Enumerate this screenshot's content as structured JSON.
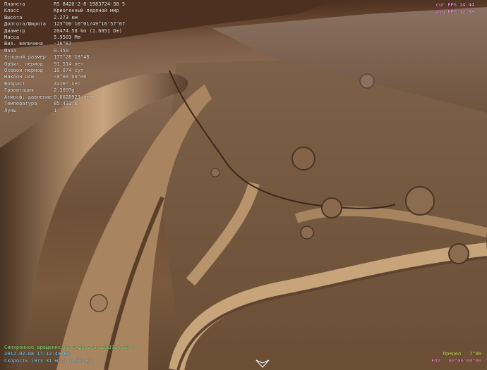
{
  "object_info": {
    "rows": [
      {
        "label": "Планета",
        "value": "RS 8420-2-8-1983724-38 5"
      },
      {
        "label": "Класс",
        "value": "Криогенный ледяной мир"
      },
      {
        "label": "Высота",
        "value": "2.273 км"
      },
      {
        "label": "Долгота/Широта",
        "value": "123°00'10\"01/49°16'57\"67"
      },
      {
        "label": "Диаметр",
        "value": "20474.58 km (1.6051 D⊕)"
      },
      {
        "label": "Масса",
        "value": "5.9503 M⊕"
      },
      {
        "label": "Виз. величина",
        "value": "-16°67"
      },
      {
        "label": "Фаза",
        "value": "0.350"
      },
      {
        "label": "Угловой размер",
        "value": "177°28'18\"46"
      },
      {
        "label": "Орбит. период",
        "value": "91.514 лет"
      },
      {
        "label": "Осевой период",
        "value": "10.074 сут"
      },
      {
        "label": "Наклон оси",
        "value": "-0°00'00\"00"
      },
      {
        "label": "Возраст",
        "value": "2x10⁹ лет"
      },
      {
        "label": "Гравитация",
        "value": "2.3097g"
      },
      {
        "label": "Атмосф. давление",
        "value": "0.0028923 атм"
      },
      {
        "label": "Температура",
        "value": "85.433 K"
      },
      {
        "label": "Луны",
        "value": "1"
      }
    ]
  },
  "fps": {
    "cur_label": "cur",
    "cur_fps_label": "FPS",
    "cur_value": "14.44",
    "avg_label": "avg",
    "avg_fps_label": "FPS",
    "avg_value": "12.88"
  },
  "status": {
    "sync_label": "Синхронное вращение",
    "sync_target": "RS 8420-2-8-1983724-38 5",
    "datetime": "2012.02.08  17:12:49.82",
    "speed_line": "Скорость (973.31 м/с) 0.00 м/с"
  },
  "view": {
    "speed_label": "Предел",
    "speed_value": "7°00",
    "fov_label": "FOV",
    "fov_value": "60°00'00\"00"
  },
  "colors": {
    "hud_text": "#e6e6e6",
    "fps_text": "#ff9fe8",
    "status_text": "#7ad8ff",
    "fov_text": "#ff8ad8",
    "limit_text": "#d8e85a"
  }
}
